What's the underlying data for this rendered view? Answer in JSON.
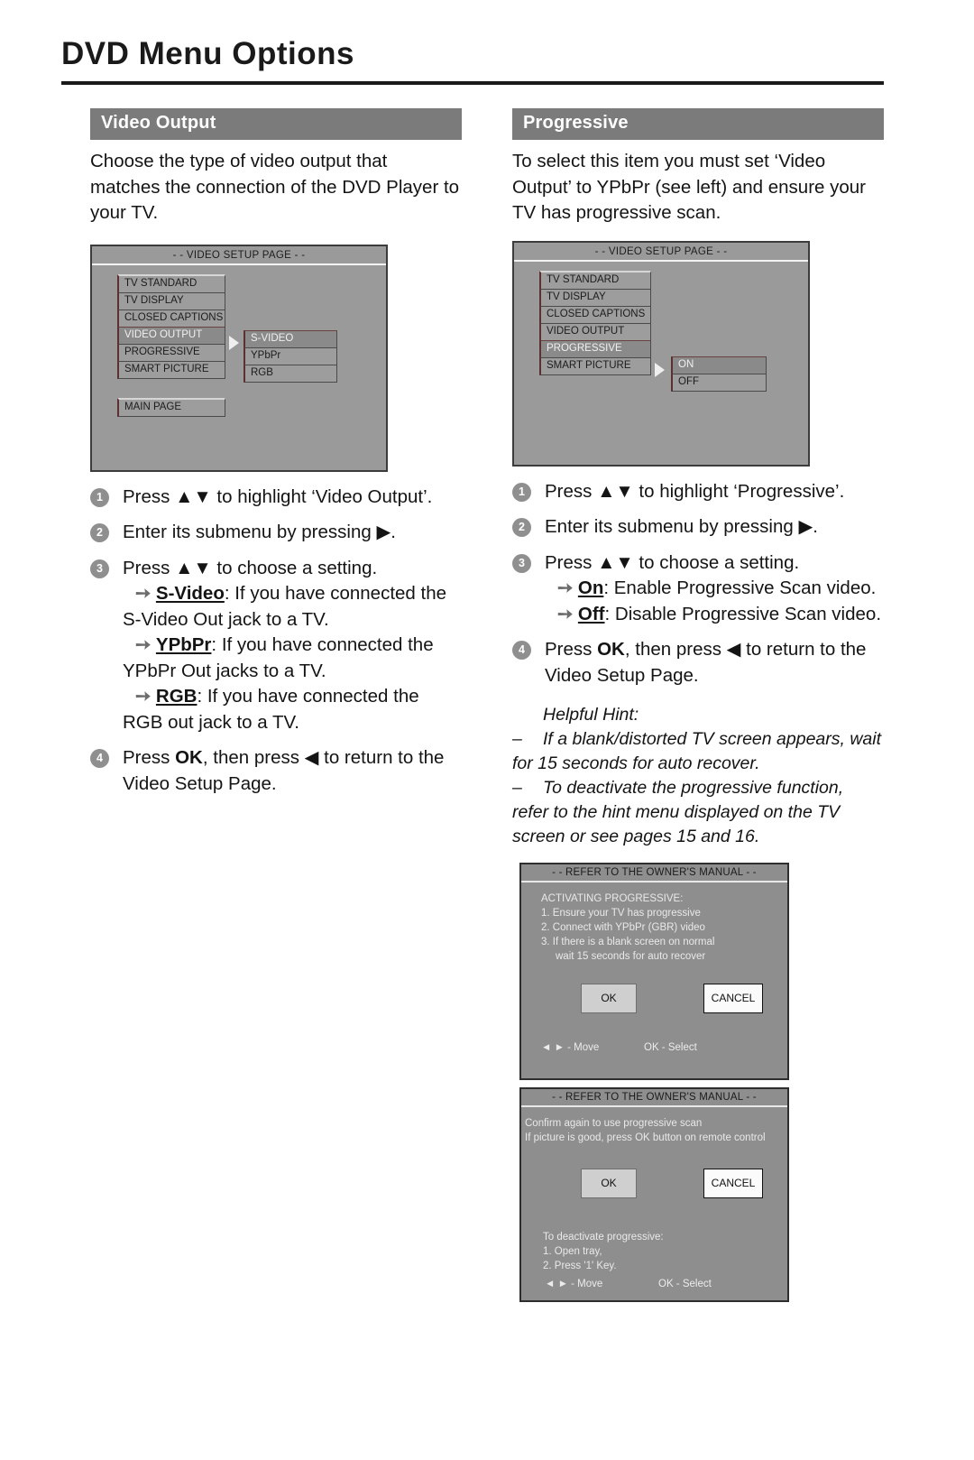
{
  "page": {
    "title": "DVD Menu Options"
  },
  "left": {
    "heading": "Video Output",
    "intro": "Choose the type of video output that matches the connection of the DVD Player to your TV.",
    "osd": {
      "title": "- - VIDEO SETUP PAGE - -",
      "menu_items": [
        "TV STANDARD",
        "TV DISPLAY",
        "CLOSED CAPTIONS",
        "VIDEO OUTPUT",
        "PROGRESSIVE",
        "SMART PICTURE"
      ],
      "selected_item": "VIDEO OUTPUT",
      "main_page_label": "MAIN PAGE",
      "submenu_items": [
        "S-VIDEO",
        "YPbPr",
        "RGB"
      ],
      "submenu_selected": "S-VIDEO"
    },
    "steps": [
      {
        "num": "1",
        "text_a": "Press ",
        "arrows": "▲▼",
        "text_b": " to highlight ‘Video Output’."
      },
      {
        "num": "2",
        "text_a": "Enter its submenu by pressing ",
        "arrows": "▶",
        "text_b": "."
      },
      {
        "num": "3",
        "text_a": "Press ",
        "arrows": "▲▼",
        "text_b": " to choose a setting."
      }
    ],
    "bullets": [
      {
        "key": "S-Video",
        "rest": ": If you have connected the S-Video Out jack to a TV."
      },
      {
        "key": "YPbPr",
        "rest": ": If you have connected the YPbPr Out jacks to a TV."
      },
      {
        "key": "RGB",
        "rest": ": If you have connected the RGB out jack to a TV."
      }
    ],
    "step4": {
      "num": "4",
      "a": "Press ",
      "ok": "OK",
      "b": ", then press ",
      "arrow": "◀",
      "c": " to return to the Video Setup Page."
    }
  },
  "right": {
    "heading": "Progressive",
    "intro": "To select this item you must set ‘Video Output’ to YPbPr (see left) and ensure your TV has progressive scan.",
    "osd": {
      "title": "- - VIDEO SETUP PAGE - -",
      "menu_items": [
        "TV STANDARD",
        "TV DISPLAY",
        "CLOSED CAPTIONS",
        "VIDEO OUTPUT",
        "PROGRESSIVE",
        "SMART PICTURE"
      ],
      "selected_item": "PROGRESSIVE",
      "submenu_items": [
        "ON",
        "OFF"
      ],
      "submenu_selected": "ON"
    },
    "steps": [
      {
        "num": "1",
        "text_a": "Press ",
        "arrows": "▲▼",
        "text_b": " to highlight ‘Progressive’."
      },
      {
        "num": "2",
        "text_a": "Enter its submenu by pressing ",
        "arrows": "▶",
        "text_b": "."
      },
      {
        "num": "3",
        "text_a": "Press ",
        "arrows": "▲▼",
        "text_b": " to choose a setting."
      }
    ],
    "bullets": [
      {
        "key": "On",
        "rest": ": Enable Progressive Scan video."
      },
      {
        "key": "Off",
        "rest": ": Disable Progressive Scan video."
      }
    ],
    "step4": {
      "num": "4",
      "a": "Press ",
      "ok": "OK",
      "b": ", then press ",
      "arrow": "◀",
      "c": " to return to the Video Setup Page."
    },
    "hint": {
      "label": "Helpful Hint:",
      "items": [
        "If a blank/distorted TV screen appears, wait for 15 seconds for auto recover.",
        "To deactivate the progressive function, refer to the hint menu displayed on the TV screen or see pages 15 and 16."
      ]
    },
    "dialog1": {
      "title": "- - REFER TO THE OWNER'S MANUAL - -",
      "lines": [
        "ACTIVATING PROGRESSIVE:",
        "1. Ensure your TV has progressive",
        "2. Connect with YPbPr (GBR) video",
        "3. If there is a blank screen on normal"
      ],
      "line_indent": "wait 15 seconds for auto recover",
      "ok_label": "OK",
      "cancel_label": "CANCEL",
      "foot_move": "◄ ► - Move",
      "foot_select": "OK - Select"
    },
    "dialog2": {
      "title": "- - REFER TO THE OWNER'S MANUAL - -",
      "lines": [
        "Confirm again to use progressive scan",
        "If picture is good, press OK button on remote control"
      ],
      "ok_label": "OK",
      "cancel_label": "CANCEL",
      "deact_lines": [
        "To deactivate progressive:",
        "1. Open tray,",
        "2. Press '1' Key."
      ],
      "foot_move": "◄ ► - Move",
      "foot_select": "OK - Select"
    }
  },
  "colors": {
    "header_bg": "#7b7b7b",
    "osd_bg": "#9a9a9a",
    "dialog_bg": "#8e8e8e",
    "num_badge": "#8f8f8f"
  }
}
